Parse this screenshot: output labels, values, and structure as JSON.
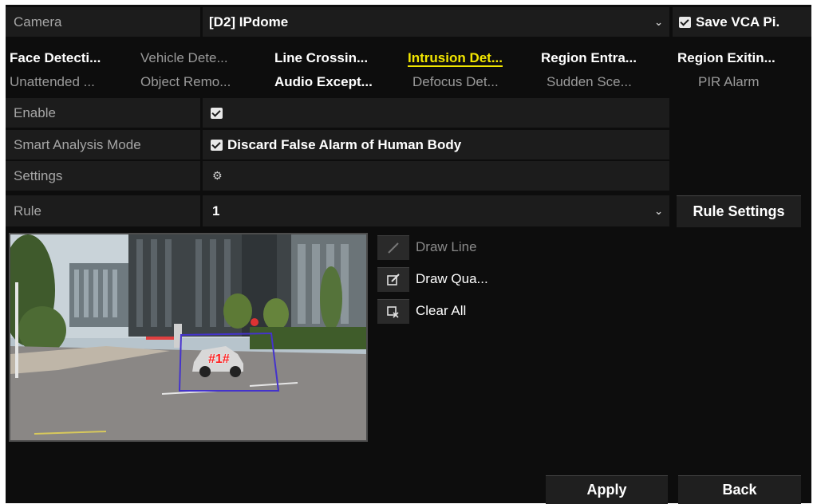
{
  "camera_row": {
    "label": "Camera",
    "value": "[D2] IPdome",
    "save_vca_label": "Save VCA Pi."
  },
  "tabs_row1": [
    {
      "label": "Face Detecti...",
      "state": "bright"
    },
    {
      "label": "Vehicle Dete...",
      "state": "dim"
    },
    {
      "label": "Line Crossin...",
      "state": "bright"
    },
    {
      "label": "Intrusion Det...",
      "state": "active"
    },
    {
      "label": "Region Entra...",
      "state": "bright"
    },
    {
      "label": "Region Exitin...",
      "state": "bright"
    }
  ],
  "tabs_row2": [
    {
      "label": "Unattended ...",
      "state": "dim"
    },
    {
      "label": "Object Remo...",
      "state": "dim"
    },
    {
      "label": "Audio Except...",
      "state": "bright"
    },
    {
      "label": "Defocus Det...",
      "state": "dim"
    },
    {
      "label": "Sudden Sce...",
      "state": "dim"
    },
    {
      "label": "PIR Alarm",
      "state": "dim"
    }
  ],
  "enable_row": {
    "label": "Enable",
    "checked": true
  },
  "smart_row": {
    "label": "Smart Analysis Mode",
    "option_label": "Discard False Alarm of Human Body",
    "checked": true
  },
  "settings_row": {
    "label": "Settings",
    "icon": "gear-icon"
  },
  "rule_row": {
    "label": "Rule",
    "value": "1",
    "button_label": "Rule Settings"
  },
  "tools": {
    "draw_line": "Draw Line",
    "draw_quad": "Draw Qua...",
    "clear_all": "Clear All"
  },
  "video": {
    "region_label": "#1#",
    "region_color": "#4433cc"
  },
  "footer": {
    "apply": "Apply",
    "back": "Back"
  },
  "colors": {
    "active_tab": "#f2e600",
    "panel_bg": "#0d0d0d",
    "row_bg": "#1c1c1c"
  }
}
